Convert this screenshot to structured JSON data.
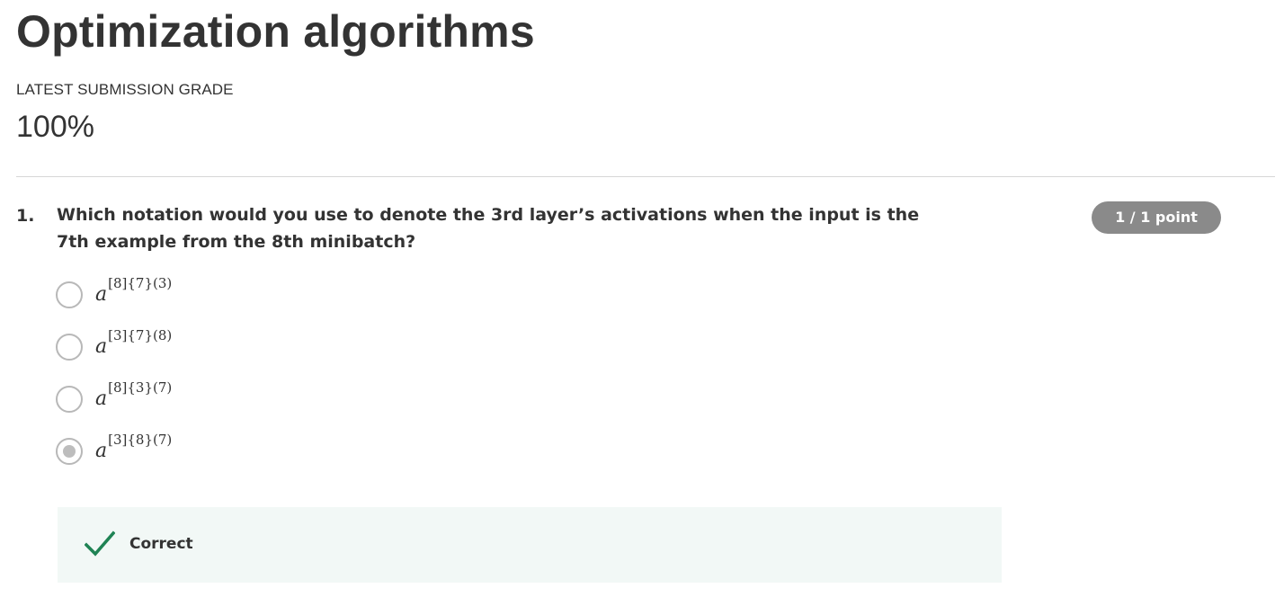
{
  "page": {
    "title": "Optimization algorithms",
    "grade_label": "LATEST SUBMISSION GRADE",
    "grade_value": "100%"
  },
  "question": {
    "number": "1.",
    "text": "Which notation would you use to denote the 3rd layer’s activations when the input is the 7th example from the 8th minibatch?",
    "points": "1 / 1 point",
    "options": [
      {
        "base": "a",
        "superscript": "[8]{7}(3)",
        "selected": false
      },
      {
        "base": "a",
        "superscript": "[3]{7}(8)",
        "selected": false
      },
      {
        "base": "a",
        "superscript": "[8]{3}(7)",
        "selected": false
      },
      {
        "base": "a",
        "superscript": "[3]{8}(7)",
        "selected": true
      }
    ]
  },
  "feedback": {
    "status": "Correct",
    "icon": "checkmark-icon",
    "color": "#1f8354"
  },
  "colors": {
    "badge": "#8a8a8a",
    "feedback_bg": "#f2f8f6",
    "radio_border": "#b8b8b8",
    "divider": "#d6d6d6"
  }
}
